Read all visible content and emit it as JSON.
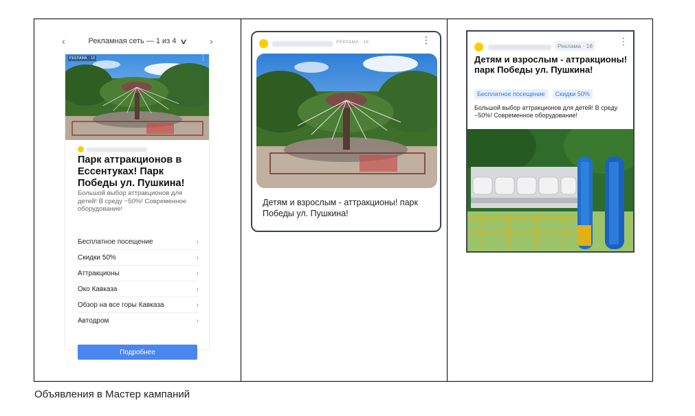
{
  "card1": {
    "pager_label": "Рекламная сеть — 1 из 4",
    "prev_arrow": "‹",
    "next_arrow": "›",
    "ad_badge": "РЕКЛАМА · 16",
    "title": "Парк аттракционов в Ессентуках! Парк Победы ул. Пушкина!",
    "description": "Большой выбор аттракционов для детей! В среду −50%! Современное оборудование!",
    "sitelinks": [
      "Бесплатное посещение",
      "Скидки 50%",
      "Аттракционы",
      "Око Кавказа",
      "Обзор на все горы Кавказа",
      "Автодром"
    ],
    "button": "Подробнее"
  },
  "card2": {
    "ad_label": "РЕКЛАМА · 16",
    "text": "Детям и взрослым - аттракционы! парк Победы ул. Пушкина!"
  },
  "card3": {
    "ad_label": "Реклама · 16",
    "title": "Детям и взрослым - аттракционы! парк Победы ул. Пушкина!",
    "tags": [
      "Бесплатное посещение",
      "Скидки 50%"
    ],
    "description": "Большой выбор аттракционов для детей! В среду −50%! Современное оборудование!"
  },
  "caption": "Объявления в Мастер кампаний",
  "colors": {
    "accent_button": "#4a86f0",
    "logo_dot": "#ffcc00",
    "tag_bg": "#e7f0fd",
    "tag_text": "#3b78d8"
  }
}
